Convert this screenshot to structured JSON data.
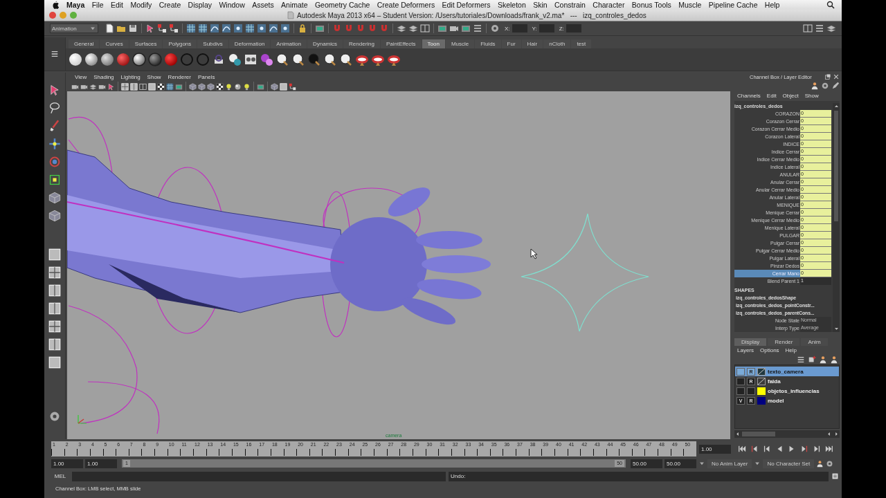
{
  "mac_menu": {
    "app": "Maya",
    "items": [
      "File",
      "Edit",
      "Modify",
      "Create",
      "Display",
      "Window",
      "Assets",
      "Animate",
      "Geometry Cache",
      "Create Deformers",
      "Edit Deformers",
      "Skeleton",
      "Skin",
      "Constrain",
      "Character",
      "Bonus Tools",
      "Muscle",
      "Pipeline Cache",
      "Help"
    ]
  },
  "title_bar": {
    "title": "Autodesk Maya 2013 x64 – Student Version: /Users/tutoriales/Downloads/frank_v2.ma*   ---   izq_controles_dedos"
  },
  "status_line": {
    "mode": "Animation",
    "coords": [
      "X:",
      "Y:",
      "Z:"
    ]
  },
  "shelf": {
    "tabs": [
      {
        "label": "General",
        "selected": false
      },
      {
        "label": "Curves",
        "selected": false
      },
      {
        "label": "Surfaces",
        "selected": false
      },
      {
        "label": "Polygons",
        "selected": false
      },
      {
        "label": "Subdivs",
        "selected": false
      },
      {
        "label": "Deformation",
        "selected": false
      },
      {
        "label": "Animation",
        "selected": false
      },
      {
        "label": "Dynamics",
        "selected": false
      },
      {
        "label": "Rendering",
        "selected": false
      },
      {
        "label": "PaintEffects",
        "selected": false
      },
      {
        "label": "Toon",
        "selected": true
      },
      {
        "label": "Muscle",
        "selected": false
      },
      {
        "label": "Fluids",
        "selected": false
      },
      {
        "label": "Fur",
        "selected": false
      },
      {
        "label": "Hair",
        "selected": false
      },
      {
        "label": "nCloth",
        "selected": false
      },
      {
        "label": "test",
        "selected": false
      }
    ]
  },
  "viewport": {
    "menus": [
      "View",
      "Shading",
      "Lighting",
      "Show",
      "Renderer",
      "Panels"
    ],
    "camera_label": "camera"
  },
  "channel_box": {
    "title": "Channel Box / Layer Editor",
    "menus": [
      "Channels",
      "Edit",
      "Object",
      "Show"
    ],
    "object": "izq_controles_dedos",
    "channels": [
      {
        "name": "CORAZON",
        "value": "0",
        "kind": "keyed",
        "selected": false
      },
      {
        "name": "Corazon Cerrar",
        "value": "0",
        "kind": "keyed",
        "selected": false
      },
      {
        "name": "Corazon Cerrar Medio",
        "value": "0",
        "kind": "keyed",
        "selected": false
      },
      {
        "name": "Corazon Lateral",
        "value": "0",
        "kind": "keyed",
        "selected": false
      },
      {
        "name": "INDICE",
        "value": "0",
        "kind": "keyed",
        "selected": false
      },
      {
        "name": "Indice Cerrar",
        "value": "0",
        "kind": "keyed",
        "selected": false
      },
      {
        "name": "Indice Cerrar Medio",
        "value": "0",
        "kind": "keyed",
        "selected": false
      },
      {
        "name": "Indice Lateral",
        "value": "0",
        "kind": "keyed",
        "selected": false
      },
      {
        "name": "ANULAR",
        "value": "0",
        "kind": "keyed",
        "selected": false
      },
      {
        "name": "Anular Cerrar",
        "value": "0",
        "kind": "keyed",
        "selected": false
      },
      {
        "name": "Anular Cerrar Medio",
        "value": "0",
        "kind": "keyed",
        "selected": false
      },
      {
        "name": "Anular Lateral",
        "value": "0",
        "kind": "keyed",
        "selected": false
      },
      {
        "name": "MENIQUE",
        "value": "0",
        "kind": "keyed",
        "selected": false
      },
      {
        "name": "Menique Cerrar",
        "value": "0",
        "kind": "keyed",
        "selected": false
      },
      {
        "name": "Menique Cerrar Medio",
        "value": "0",
        "kind": "keyed",
        "selected": false
      },
      {
        "name": "Menique Lateral",
        "value": "0",
        "kind": "keyed",
        "selected": false
      },
      {
        "name": "PULGAR",
        "value": "0",
        "kind": "keyed",
        "selected": false
      },
      {
        "name": "Pulgar Cerrar",
        "value": "0",
        "kind": "keyed",
        "selected": false
      },
      {
        "name": "Pulgar Cerrar Medio",
        "value": "0",
        "kind": "keyed",
        "selected": false
      },
      {
        "name": "Pulgar Lateral",
        "value": "0",
        "kind": "keyed",
        "selected": false
      },
      {
        "name": "Pinzar Dedos",
        "value": "0",
        "kind": "keyed",
        "selected": false
      },
      {
        "name": "Cerrar Mano",
        "value": "0",
        "kind": "keyed",
        "selected": true
      },
      {
        "name": "Blend Parent 1",
        "value": "1",
        "kind": "plain",
        "selected": false
      }
    ],
    "shapes_header": "SHAPES",
    "shapes": [
      "izq_controles_dedosShape",
      "izq_controles_dedos_pointConstr...",
      "izq_controles_dedos_parentCons..."
    ],
    "attributes": [
      {
        "name": "Node State",
        "value": "Normal"
      },
      {
        "name": "Interp Type",
        "value": "Average"
      }
    ]
  },
  "layer_editor": {
    "tabs": [
      {
        "label": "Display",
        "selected": true
      },
      {
        "label": "Render",
        "selected": false
      },
      {
        "label": "Anim",
        "selected": false
      }
    ],
    "menus": [
      "Layers",
      "Options",
      "Help"
    ],
    "layers": [
      {
        "name": "texto_camera",
        "render_flag": "R",
        "selected": true
      },
      {
        "name": "falda",
        "render_flag": "R",
        "selected": false
      },
      {
        "name": "objetos_influencias",
        "color": "#ffff00",
        "selected": false
      },
      {
        "name": "model",
        "visible_flag": "V",
        "render_flag": "R",
        "color": "#000080",
        "selected": false
      }
    ]
  },
  "timeline": {
    "frames": [
      "1",
      "2",
      "3",
      "4",
      "5",
      "6",
      "7",
      "8",
      "9",
      "10",
      "11",
      "12",
      "13",
      "14",
      "15",
      "16",
      "17",
      "18",
      "19",
      "20",
      "21",
      "22",
      "23",
      "24",
      "25",
      "26",
      "27",
      "28",
      "29",
      "30",
      "31",
      "32",
      "33",
      "34",
      "35",
      "36",
      "37",
      "38",
      "39",
      "40",
      "41",
      "42",
      "43",
      "44",
      "45",
      "46",
      "47",
      "48",
      "49",
      "50"
    ],
    "current_frame": "1.00"
  },
  "range_slider": {
    "level": 1,
    "start": "1.00",
    "range_start": "1.00",
    "handle_start": "1",
    "handle_end": "50",
    "range_end": "50.00",
    "end": "50.00",
    "anim_layer": "No Anim Layer",
    "character_set": "No Character Set"
  },
  "command_line": {
    "label": "MEL",
    "result": "Undo:"
  },
  "help_line": {
    "text": "Channel Box: LMB select, MMB slide"
  }
}
